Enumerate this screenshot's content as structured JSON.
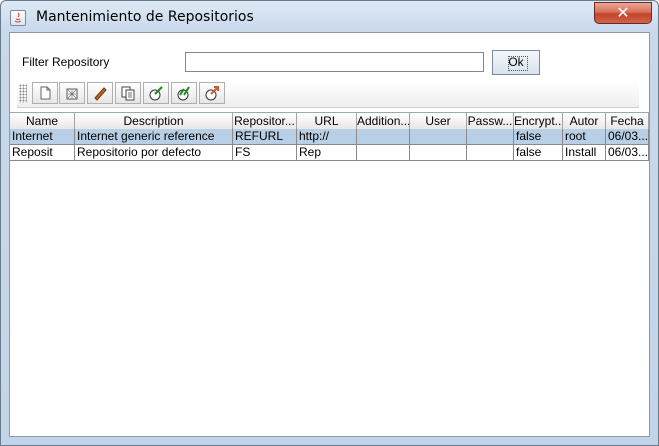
{
  "window": {
    "title": "Mantenimiento de Repositorios",
    "close_symbol": "✕"
  },
  "filter": {
    "label": "Filter Repository",
    "value": "",
    "ok_label": "Ok"
  },
  "toolbar": {
    "buttons": [
      {
        "icon": "new-document-icon"
      },
      {
        "icon": "delete-icon"
      },
      {
        "icon": "edit-pencil-icon"
      },
      {
        "icon": "copy-icon"
      },
      {
        "icon": "check-green-icon"
      },
      {
        "icon": "check-all-icon"
      },
      {
        "icon": "export-icon"
      }
    ]
  },
  "table": {
    "columns": [
      "Name",
      "Description",
      "Repositor...",
      "URL",
      "Addition...",
      "User",
      "Passw...",
      "Encrypt...",
      "Autor",
      "Fecha"
    ],
    "rows": [
      {
        "selected": true,
        "cells": [
          "Internet",
          "Internet generic reference",
          "REFURL",
          "http://",
          "",
          "",
          "",
          "false",
          "root",
          "06/03..."
        ]
      },
      {
        "selected": false,
        "cells": [
          "Reposit",
          "Repositorio por defecto",
          "FS",
          "Rep",
          "",
          "",
          "",
          "false",
          "Install",
          "06/03..."
        ]
      }
    ]
  },
  "colors": {
    "selection": "#b8cfe5",
    "close_button": "#c4432b",
    "title_bar": "#c9d9ec"
  }
}
